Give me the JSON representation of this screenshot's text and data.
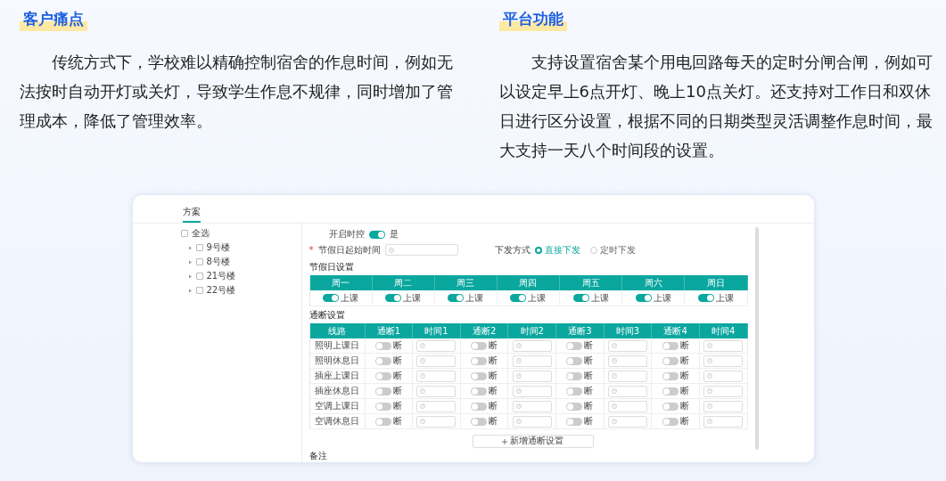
{
  "sections": [
    {
      "heading": "客户痛点",
      "body": "传统方式下，学校难以精确控制宿舍的作息时间，例如无法按时自动开灯或关灯，导致学生作息不规律，同时增加了管理成本，降低了管理效率。"
    },
    {
      "heading": "平台功能",
      "body": "支持设置宿舍某个用电回路每天的定时分闸合闸，例如可以设定早上6点开灯、晚上10点关灯。还支持对工作日和双休日进行区分设置，根据不同的日期类型灵活调整作息时间，最大支持一天八个时间段的设置。"
    }
  ],
  "app": {
    "tabs": [
      {
        "label": "方案",
        "selected": true
      }
    ],
    "tree": {
      "select_all": {
        "label": "全选",
        "checked": false
      },
      "items": [
        {
          "label": "9号楼",
          "checked": false,
          "expanded": false
        },
        {
          "label": "8号楼",
          "checked": false,
          "expanded": false
        },
        {
          "label": "21号楼",
          "checked": false,
          "expanded": false
        },
        {
          "label": "22号楼",
          "checked": false,
          "expanded": false
        }
      ]
    },
    "timer_switch": {
      "label": "开启时控",
      "on": true,
      "value": "是"
    },
    "holiday_start": {
      "marker": "*",
      "label": "节假日起始时间"
    },
    "dispatch": {
      "label": "下发方式",
      "options": [
        {
          "label": "直接下发",
          "selected": true
        },
        {
          "label": "定时下发",
          "selected": false
        }
      ]
    },
    "holiday_settings": {
      "title": "节假日设置",
      "days": [
        {
          "label": "周一",
          "on": true,
          "state": "上课"
        },
        {
          "label": "周二",
          "on": true,
          "state": "上课"
        },
        {
          "label": "周三",
          "on": true,
          "state": "上课"
        },
        {
          "label": "周四",
          "on": true,
          "state": "上课"
        },
        {
          "label": "周五",
          "on": true,
          "state": "上课"
        },
        {
          "label": "周六",
          "on": true,
          "state": "上课"
        },
        {
          "label": "周日",
          "on": true,
          "state": "上课"
        }
      ]
    },
    "breaker_settings": {
      "title": "通断设置",
      "columns": [
        "线路",
        "通断1",
        "时间1",
        "通断2",
        "时间2",
        "通断3",
        "时间3",
        "通断4",
        "时间4"
      ],
      "rows": [
        {
          "name": "照明上课日",
          "switches": [
            {
              "on": false,
              "state": "断"
            },
            {
              "on": false,
              "state": "断"
            },
            {
              "on": false,
              "state": "断"
            },
            {
              "on": false,
              "state": "断"
            }
          ]
        },
        {
          "name": "照明休息日",
          "switches": [
            {
              "on": false,
              "state": "断"
            },
            {
              "on": false,
              "state": "断"
            },
            {
              "on": false,
              "state": "断"
            },
            {
              "on": false,
              "state": "断"
            }
          ]
        },
        {
          "name": "插座上课日",
          "switches": [
            {
              "on": false,
              "state": "断"
            },
            {
              "on": false,
              "state": "断"
            },
            {
              "on": false,
              "state": "断"
            },
            {
              "on": false,
              "state": "断"
            }
          ]
        },
        {
          "name": "插座休息日",
          "switches": [
            {
              "on": false,
              "state": "断"
            },
            {
              "on": false,
              "state": "断"
            },
            {
              "on": false,
              "state": "断"
            },
            {
              "on": false,
              "state": "断"
            }
          ]
        },
        {
          "name": "空调上课日",
          "switches": [
            {
              "on": false,
              "state": "断"
            },
            {
              "on": false,
              "state": "断"
            },
            {
              "on": false,
              "state": "断"
            },
            {
              "on": false,
              "state": "断"
            }
          ]
        },
        {
          "name": "空调休息日",
          "switches": [
            {
              "on": false,
              "state": "断"
            },
            {
              "on": false,
              "state": "断"
            },
            {
              "on": false,
              "state": "断"
            },
            {
              "on": false,
              "state": "断"
            }
          ]
        }
      ]
    },
    "add_button": "新增通断设置",
    "notes_label": "备注"
  }
}
